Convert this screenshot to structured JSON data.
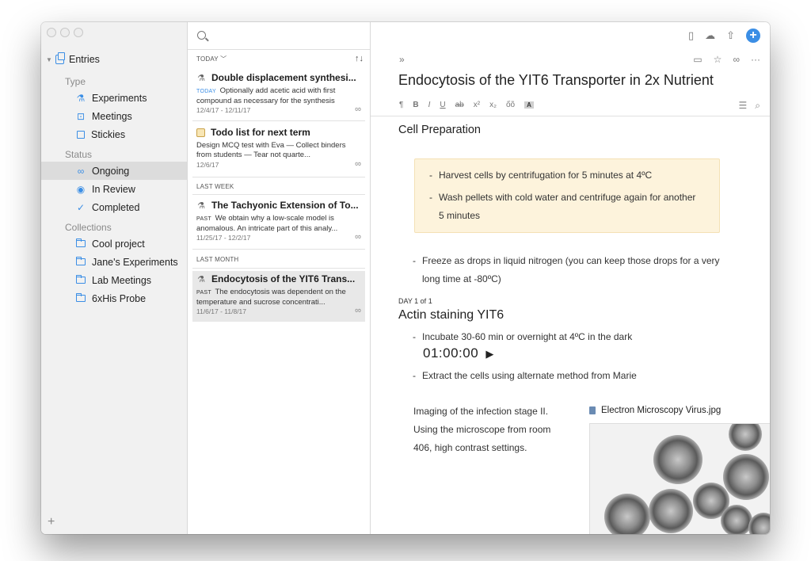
{
  "sidebar": {
    "root_label": "Entries",
    "sections": {
      "type": "Type",
      "status": "Status",
      "collections": "Collections"
    },
    "type_items": [
      {
        "label": "Experiments",
        "icon": "flask-icon"
      },
      {
        "label": "Meetings",
        "icon": "meetings-icon"
      },
      {
        "label": "Stickies",
        "icon": "sticky-icon"
      }
    ],
    "status_items": [
      {
        "label": "Ongoing",
        "icon": "infinity-icon",
        "selected": true
      },
      {
        "label": "In Review",
        "icon": "eye-icon"
      },
      {
        "label": "Completed",
        "icon": "checkmark-icon"
      }
    ],
    "collections": [
      {
        "label": "Cool project"
      },
      {
        "label": "Jane's Experiments"
      },
      {
        "label": "Lab Meetings"
      },
      {
        "label": "6xHis Probe"
      }
    ],
    "add_label": "+"
  },
  "list": {
    "groups": {
      "today": "TODAY",
      "last_week": "LAST WEEK",
      "last_month": "LAST MONTH"
    },
    "entries": [
      {
        "title": "Double displacement synthesi...",
        "prefix": "TODAY",
        "snippet": "Optionally add acetic acid with first compound as necessary for the synthesis",
        "date": "12/4/17 - 12/11/17"
      },
      {
        "title": "Todo list for next term",
        "prefix": "",
        "snippet": "Design MCQ test with Eva — Collect binders from students — Tear not quarte...",
        "date": "12/6/17"
      },
      {
        "title": "The Tachyonic Extension of To...",
        "prefix": "PAST",
        "snippet": "We obtain why a low-scale model is anomalous. An intricate part of this analy...",
        "date": "11/25/17 - 12/2/17"
      },
      {
        "title": "Endocytosis of the YIT6 Trans...",
        "prefix": "PAST",
        "snippet": "The endocytosis was dependent on the temperature and sucrose concentrati...",
        "date": "11/6/17 - 11/8/17",
        "selected": true
      }
    ]
  },
  "editor": {
    "title": "Endocytosis of the YIT6 Transporter in 2x Nutrient",
    "format_bar": [
      "¶",
      "B",
      "I",
      "U",
      "ab",
      "x²",
      "x₂",
      "ốõ",
      "A"
    ],
    "section1_heading": "Cell Preparation",
    "callout_items": [
      "Harvest cells by centrifugation for 5 minutes at 4ºC",
      "Wash pellets with cold water and centrifuge again for another 5 minutes"
    ],
    "bullet_freeze": "Freeze as drops in liquid nitrogen (you can keep those drops for a very long time at -80ºC)",
    "day_label": "DAY 1 of 1",
    "section2_heading": "Actin staining YIT6",
    "bullet_incubate": "Incubate 30-60 min or overnight at 4ºC in the dark",
    "timer": "01:00:00",
    "bullet_extract": "Extract the cells using alternate method from Marie",
    "imaging_text": "Imaging of the infection stage II. Using the microscope from room 406, high contrast settings.",
    "attachment_name": "Electron Microscopy Virus.jpg"
  }
}
